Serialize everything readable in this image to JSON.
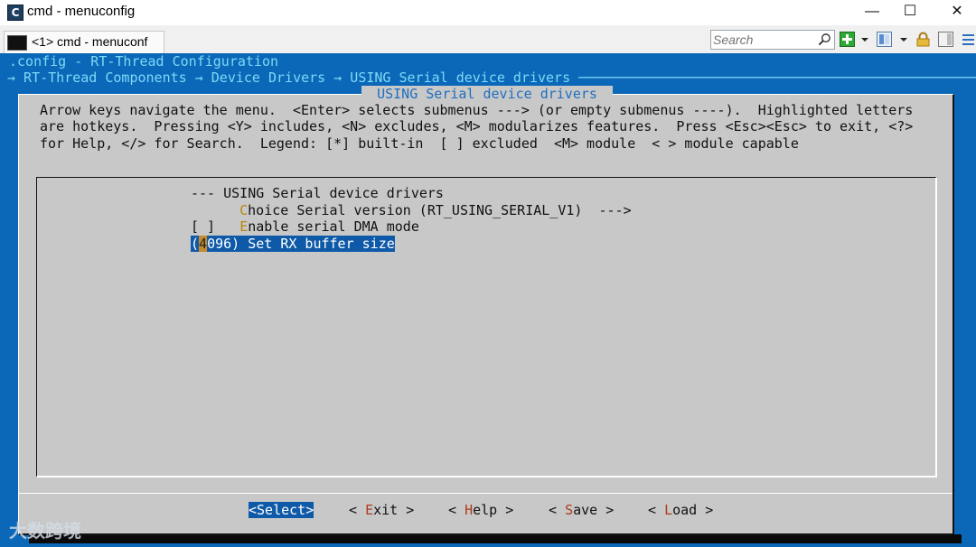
{
  "window": {
    "title": "cmd - menuconfig",
    "app_icon_letter": "C",
    "controls": {
      "minimize": "—",
      "maximize": "☐",
      "close": "✕"
    }
  },
  "tabs": [
    {
      "label": "<1> cmd - menuconf",
      "icon": "console-icon"
    }
  ],
  "toolbar": {
    "search_placeholder": "Search",
    "icons": [
      "search-icon",
      "add-tab-icon",
      "dropdown-arrow-icon",
      "panes-icon",
      "dropdown-arrow-icon",
      "lock-icon",
      "window-icon",
      "hamburger-menu-icon"
    ]
  },
  "terminal": {
    "config_line": ".config - RT-Thread Configuration",
    "breadcrumb_line": "→ RT-Thread Components → Device Drivers → USING Serial device drivers ─────────────────────────────────────────────────",
    "dialog_title": " USING Serial device drivers ",
    "help_lines": [
      "Arrow keys navigate the menu.  <Enter> selects submenus ---> (or empty submenus ----).  Highlighted letters",
      "are hotkeys.  Pressing <Y> includes, <N> excludes, <M> modularizes features.  Press <Esc><Esc> to exit, <?>",
      "for Help, </> for Search.  Legend: [*] built-in  [ ] excluded  <M> module  < > module capable"
    ],
    "menu": {
      "header": "--- USING Serial device drivers",
      "choice": {
        "pre": "    ",
        "hot": "C",
        "rest": "hoice Serial version (RT_USING_SERIAL_V1)  --->"
      },
      "dma": {
        "pre": "[ ]   ",
        "hot": "E",
        "rest": "nable serial DMA mode"
      },
      "rx": {
        "open": "(",
        "cursor": "4",
        "rest": "096) Set RX buffer size"
      }
    },
    "buttons": [
      {
        "name": "select-button",
        "text": "<Select>"
      },
      {
        "name": "exit-button",
        "pre": "< ",
        "hot": "E",
        "rest": "xit >"
      },
      {
        "name": "help-button",
        "pre": "< ",
        "hot": "H",
        "rest": "elp >"
      },
      {
        "name": "save-button",
        "pre": "< ",
        "hot": "S",
        "rest": "ave >"
      },
      {
        "name": "load-button",
        "pre": "< ",
        "hot": "L",
        "rest": "oad >"
      }
    ]
  },
  "watermark": "大数跨境",
  "colors": {
    "terminal_bg": "#0b67b8",
    "dialog_bg": "#c8c8c8",
    "highlight": "#0f5aa8",
    "cursor": "#c58a2b",
    "hotkey": "#b03a1c",
    "title_text": "#1f6fbf"
  }
}
